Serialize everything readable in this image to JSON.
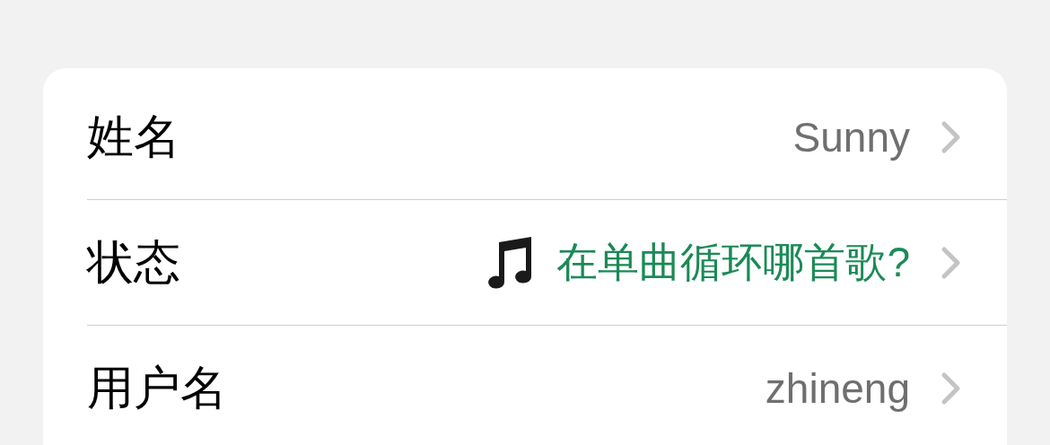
{
  "rows": [
    {
      "kind": "plain",
      "label": "姓名",
      "value": "Sunny"
    },
    {
      "kind": "status",
      "label": "状态",
      "value": "在单曲循环哪首歌?"
    },
    {
      "kind": "plain",
      "label": "用户名",
      "value": "zhineng"
    }
  ]
}
